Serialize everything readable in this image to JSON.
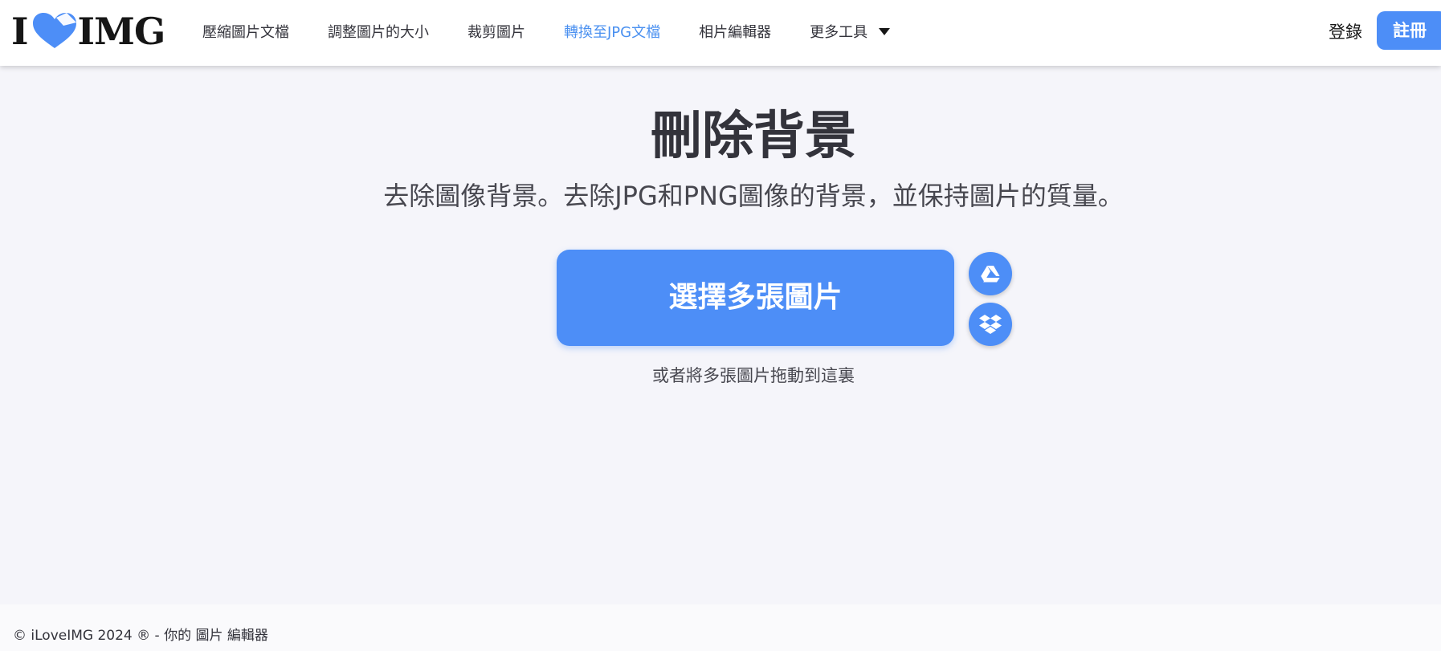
{
  "brand": {
    "logo_left": "I",
    "logo_right": "IMG",
    "heart_color": "#4d8ef7"
  },
  "nav": {
    "items": [
      {
        "label": "壓縮圖片文檔",
        "active": false
      },
      {
        "label": "調整圖片的大小",
        "active": false
      },
      {
        "label": "裁剪圖片",
        "active": false
      },
      {
        "label": "轉換至JPG文檔",
        "active": true
      },
      {
        "label": "相片編輯器",
        "active": false
      },
      {
        "label": "更多工具",
        "active": false,
        "dropdown": true
      }
    ],
    "login": "登錄",
    "signup": "註冊"
  },
  "main": {
    "title": "刪除背景",
    "subtitle": "去除圖像背景。去除JPG和PNG圖像的背景，並保持圖片的質量。",
    "select_button": "選擇多張圖片",
    "cloud_buttons": [
      "google-drive-icon",
      "dropbox-icon"
    ],
    "drop_hint": "或者將多張圖片拖動到這裏"
  },
  "footer": {
    "text": "© iLoveIMG 2024 ® - 你的 圖片 編輯器"
  },
  "colors": {
    "accent": "#4d8ef7",
    "active_nav": "#4a90f0",
    "background": "#f5f5fa",
    "text": "#33333b"
  }
}
